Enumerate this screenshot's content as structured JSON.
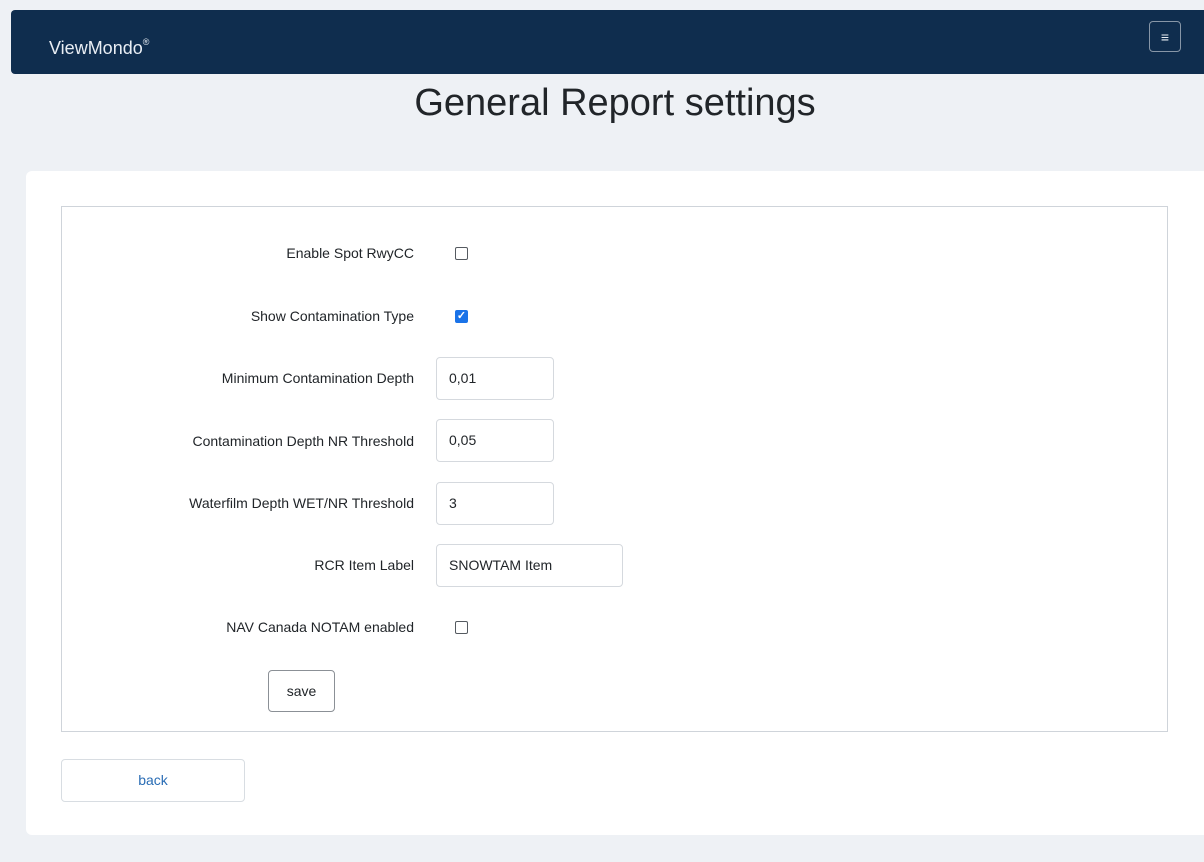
{
  "navbar": {
    "brand": "ViewMondo",
    "brand_mark": "®",
    "menu_icon": "hamburger-menu-icon",
    "menu_glyph": "≡"
  },
  "page": {
    "title": "General Report settings"
  },
  "form": {
    "enable_spot_rwycc": {
      "label": "Enable Spot RwyCC",
      "checked": false
    },
    "show_contamination_type": {
      "label": "Show Contamination Type",
      "checked": true,
      "check_glyph": "✓"
    },
    "minimum_contamination_depth": {
      "label": "Minimum Contamination Depth",
      "value": "0,01"
    },
    "contamination_depth_nr_threshold": {
      "label": "Contamination Depth NR Threshold",
      "value": "0,05"
    },
    "waterfilm_depth_threshold": {
      "label": "Waterfilm Depth WET/NR Threshold",
      "value": "3"
    },
    "rcr_item_label": {
      "label": "RCR Item Label",
      "value": "SNOWTAM Item"
    },
    "nav_canada_notam": {
      "label": "NAV Canada NOTAM enabled",
      "checked": false
    },
    "save_label": "save"
  },
  "footer": {
    "back_label": "back"
  },
  "colors": {
    "navbar": "#0f2d4e",
    "background": "#eef1f5",
    "checkbox_checked": "#1a73e8",
    "link": "#2a6db5"
  }
}
